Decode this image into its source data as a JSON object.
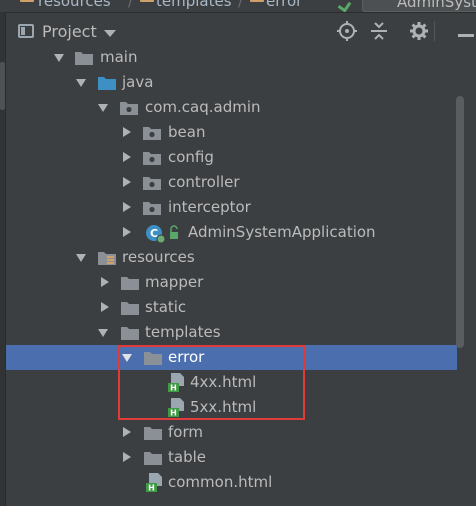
{
  "breadcrumb": {
    "items": [
      "resources",
      "templates",
      "error"
    ],
    "run_config": "AdminSyst"
  },
  "panel": {
    "title": "Project",
    "buttons": {
      "locate": "locate-icon",
      "collapse": "collapse-all-icon",
      "settings": "gear-icon",
      "hide": "minimize-icon"
    }
  },
  "tree": {
    "rows": [
      {
        "label": "main",
        "type": "folder",
        "expanded": true
      },
      {
        "label": "java",
        "type": "source-folder",
        "expanded": true
      },
      {
        "label": "com.caq.admin",
        "type": "package",
        "expanded": true
      },
      {
        "label": "bean",
        "type": "package",
        "expanded": false
      },
      {
        "label": "config",
        "type": "package",
        "expanded": false
      },
      {
        "label": "controller",
        "type": "package",
        "expanded": false
      },
      {
        "label": "interceptor",
        "type": "package",
        "expanded": false
      },
      {
        "label": "AdminSystemApplication",
        "type": "spring-boot-class",
        "expanded": false
      },
      {
        "label": "resources",
        "type": "resources-folder",
        "expanded": true
      },
      {
        "label": "mapper",
        "type": "folder",
        "expanded": false
      },
      {
        "label": "static",
        "type": "folder",
        "expanded": false
      },
      {
        "label": "templates",
        "type": "folder",
        "expanded": true
      },
      {
        "label": "error",
        "type": "folder",
        "expanded": true,
        "selected": true
      },
      {
        "label": "4xx.html",
        "type": "html-file"
      },
      {
        "label": "5xx.html",
        "type": "html-file"
      },
      {
        "label": "form",
        "type": "folder",
        "expanded": false
      },
      {
        "label": "table",
        "type": "folder",
        "expanded": false
      },
      {
        "label": "common.html",
        "type": "html-file"
      }
    ]
  },
  "colors": {
    "background": "#3c3f41",
    "selection": "#4b6eaf",
    "highlight_box": "#e03b3b",
    "folder": "#8a9095",
    "html_icon": "#3f9b45"
  }
}
